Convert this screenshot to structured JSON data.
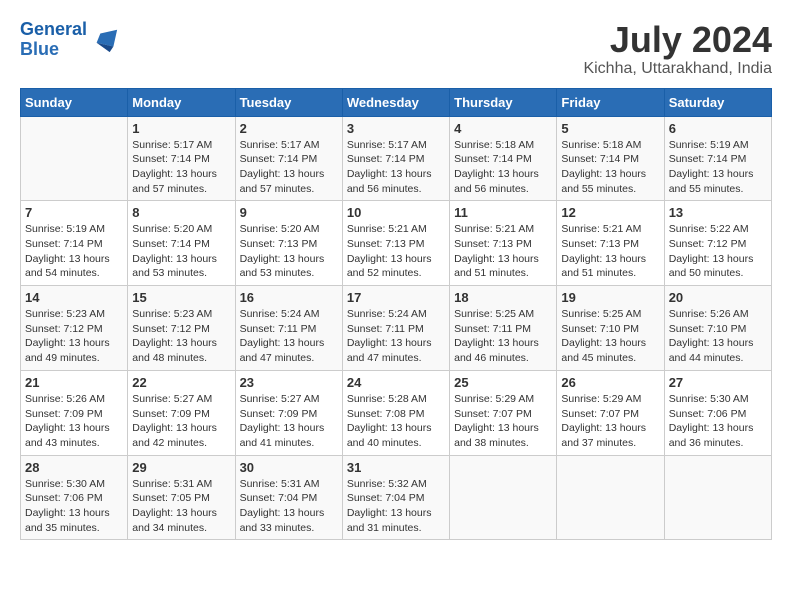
{
  "logo": {
    "line1": "General",
    "line2": "Blue"
  },
  "title": "July 2024",
  "location": "Kichha, Uttarakhand, India",
  "days_header": [
    "Sunday",
    "Monday",
    "Tuesday",
    "Wednesday",
    "Thursday",
    "Friday",
    "Saturday"
  ],
  "weeks": [
    [
      {
        "day": "",
        "info": ""
      },
      {
        "day": "1",
        "info": "Sunrise: 5:17 AM\nSunset: 7:14 PM\nDaylight: 13 hours\nand 57 minutes."
      },
      {
        "day": "2",
        "info": "Sunrise: 5:17 AM\nSunset: 7:14 PM\nDaylight: 13 hours\nand 57 minutes."
      },
      {
        "day": "3",
        "info": "Sunrise: 5:17 AM\nSunset: 7:14 PM\nDaylight: 13 hours\nand 56 minutes."
      },
      {
        "day": "4",
        "info": "Sunrise: 5:18 AM\nSunset: 7:14 PM\nDaylight: 13 hours\nand 56 minutes."
      },
      {
        "day": "5",
        "info": "Sunrise: 5:18 AM\nSunset: 7:14 PM\nDaylight: 13 hours\nand 55 minutes."
      },
      {
        "day": "6",
        "info": "Sunrise: 5:19 AM\nSunset: 7:14 PM\nDaylight: 13 hours\nand 55 minutes."
      }
    ],
    [
      {
        "day": "7",
        "info": "Sunrise: 5:19 AM\nSunset: 7:14 PM\nDaylight: 13 hours\nand 54 minutes."
      },
      {
        "day": "8",
        "info": "Sunrise: 5:20 AM\nSunset: 7:14 PM\nDaylight: 13 hours\nand 53 minutes."
      },
      {
        "day": "9",
        "info": "Sunrise: 5:20 AM\nSunset: 7:13 PM\nDaylight: 13 hours\nand 53 minutes."
      },
      {
        "day": "10",
        "info": "Sunrise: 5:21 AM\nSunset: 7:13 PM\nDaylight: 13 hours\nand 52 minutes."
      },
      {
        "day": "11",
        "info": "Sunrise: 5:21 AM\nSunset: 7:13 PM\nDaylight: 13 hours\nand 51 minutes."
      },
      {
        "day": "12",
        "info": "Sunrise: 5:21 AM\nSunset: 7:13 PM\nDaylight: 13 hours\nand 51 minutes."
      },
      {
        "day": "13",
        "info": "Sunrise: 5:22 AM\nSunset: 7:12 PM\nDaylight: 13 hours\nand 50 minutes."
      }
    ],
    [
      {
        "day": "14",
        "info": "Sunrise: 5:23 AM\nSunset: 7:12 PM\nDaylight: 13 hours\nand 49 minutes."
      },
      {
        "day": "15",
        "info": "Sunrise: 5:23 AM\nSunset: 7:12 PM\nDaylight: 13 hours\nand 48 minutes."
      },
      {
        "day": "16",
        "info": "Sunrise: 5:24 AM\nSunset: 7:11 PM\nDaylight: 13 hours\nand 47 minutes."
      },
      {
        "day": "17",
        "info": "Sunrise: 5:24 AM\nSunset: 7:11 PM\nDaylight: 13 hours\nand 47 minutes."
      },
      {
        "day": "18",
        "info": "Sunrise: 5:25 AM\nSunset: 7:11 PM\nDaylight: 13 hours\nand 46 minutes."
      },
      {
        "day": "19",
        "info": "Sunrise: 5:25 AM\nSunset: 7:10 PM\nDaylight: 13 hours\nand 45 minutes."
      },
      {
        "day": "20",
        "info": "Sunrise: 5:26 AM\nSunset: 7:10 PM\nDaylight: 13 hours\nand 44 minutes."
      }
    ],
    [
      {
        "day": "21",
        "info": "Sunrise: 5:26 AM\nSunset: 7:09 PM\nDaylight: 13 hours\nand 43 minutes."
      },
      {
        "day": "22",
        "info": "Sunrise: 5:27 AM\nSunset: 7:09 PM\nDaylight: 13 hours\nand 42 minutes."
      },
      {
        "day": "23",
        "info": "Sunrise: 5:27 AM\nSunset: 7:09 PM\nDaylight: 13 hours\nand 41 minutes."
      },
      {
        "day": "24",
        "info": "Sunrise: 5:28 AM\nSunset: 7:08 PM\nDaylight: 13 hours\nand 40 minutes."
      },
      {
        "day": "25",
        "info": "Sunrise: 5:29 AM\nSunset: 7:07 PM\nDaylight: 13 hours\nand 38 minutes."
      },
      {
        "day": "26",
        "info": "Sunrise: 5:29 AM\nSunset: 7:07 PM\nDaylight: 13 hours\nand 37 minutes."
      },
      {
        "day": "27",
        "info": "Sunrise: 5:30 AM\nSunset: 7:06 PM\nDaylight: 13 hours\nand 36 minutes."
      }
    ],
    [
      {
        "day": "28",
        "info": "Sunrise: 5:30 AM\nSunset: 7:06 PM\nDaylight: 13 hours\nand 35 minutes."
      },
      {
        "day": "29",
        "info": "Sunrise: 5:31 AM\nSunset: 7:05 PM\nDaylight: 13 hours\nand 34 minutes."
      },
      {
        "day": "30",
        "info": "Sunrise: 5:31 AM\nSunset: 7:04 PM\nDaylight: 13 hours\nand 33 minutes."
      },
      {
        "day": "31",
        "info": "Sunrise: 5:32 AM\nSunset: 7:04 PM\nDaylight: 13 hours\nand 31 minutes."
      },
      {
        "day": "",
        "info": ""
      },
      {
        "day": "",
        "info": ""
      },
      {
        "day": "",
        "info": ""
      }
    ]
  ]
}
